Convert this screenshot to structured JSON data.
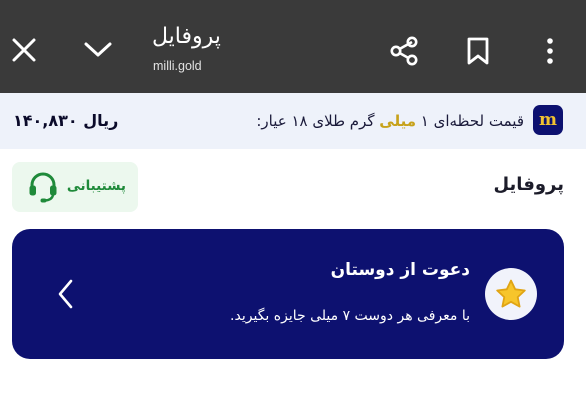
{
  "browser": {
    "title": "پروفایل",
    "url": "milli.gold",
    "icons": {
      "close": "close-icon",
      "minimize": "chevron-down-icon",
      "share": "share-icon",
      "bookmark": "bookmark-icon",
      "menu": "more-vertical-icon"
    }
  },
  "price_bar": {
    "logo_text": "m",
    "label_before": "قیمت لحظه‌ای ۱",
    "label_highlight": "میلی",
    "label_after": "گرم طلای ۱۸ عیار:",
    "value": "۱۴۰,۸۳۰ ریال",
    "highlight_color": "#c7a21a"
  },
  "page": {
    "title": "پروفایل",
    "support_label": "پشتیبانی"
  },
  "invite_card": {
    "title": "دعوت از دوستان",
    "description": "با معرفی هر دوست ۷ میلی جایزه بگیرید.",
    "icon": "star-icon",
    "background_color": "#0d1170"
  }
}
